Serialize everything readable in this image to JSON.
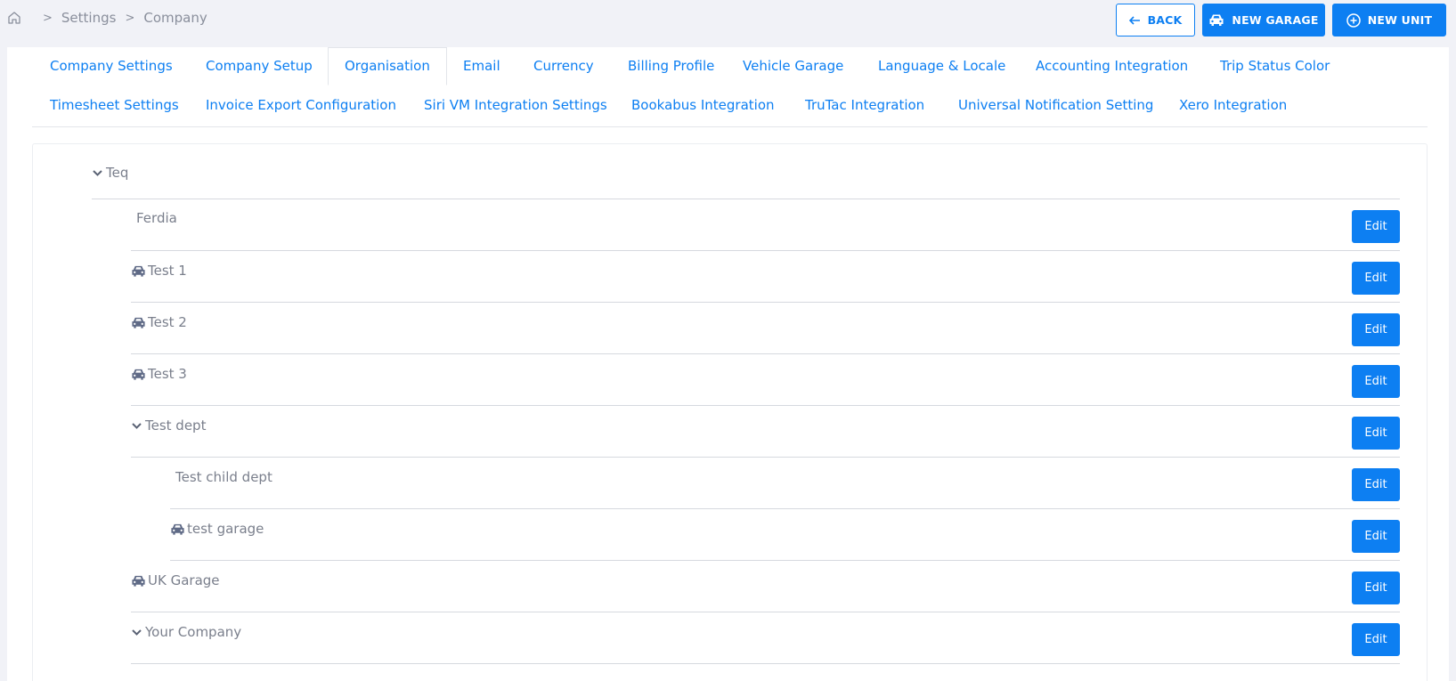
{
  "breadcrumb": {
    "items": [
      "Settings",
      "Company"
    ]
  },
  "actions": {
    "back": "BACK",
    "new_garage": "NEW GARAGE",
    "new_unit": "NEW UNIT"
  },
  "tabs": [
    "Company Settings",
    "Company Setup",
    "Organisation",
    "Email",
    "Currency",
    "Billing Profile",
    "Vehicle Garage",
    "Language & Locale",
    "Accounting Integration",
    "Trip Status Color",
    "Timesheet Settings",
    "Invoice Export Configuration",
    "Siri VM Integration Settings",
    "Bookabus Integration",
    "TruTac Integration",
    "Universal Notification Setting",
    "Xero Integration"
  ],
  "active_tab": "Organisation",
  "tree": {
    "root": "Teq",
    "nodes": [
      {
        "label": "Ferdia",
        "icon": "none",
        "edit": "Edit"
      },
      {
        "label": "Test 1",
        "icon": "car-icon",
        "edit": "Edit"
      },
      {
        "label": "Test 2",
        "icon": "car-icon",
        "edit": "Edit"
      },
      {
        "label": "Test 3",
        "icon": "car-icon",
        "edit": "Edit"
      },
      {
        "label": "Test dept",
        "icon": "chevron-down-icon",
        "edit": "Edit"
      },
      {
        "label": "Test child dept",
        "icon": "none",
        "edit": "Edit"
      },
      {
        "label": "test garage",
        "icon": "car-icon",
        "edit": "Edit"
      },
      {
        "label": "UK Garage",
        "icon": "car-icon",
        "edit": "Edit"
      },
      {
        "label": "Your Company",
        "icon": "chevron-down-icon",
        "edit": "Edit"
      }
    ]
  },
  "colors": {
    "accent": "#0d7ff2",
    "background": "#f1f2f7",
    "text": "#7a7f8c"
  }
}
